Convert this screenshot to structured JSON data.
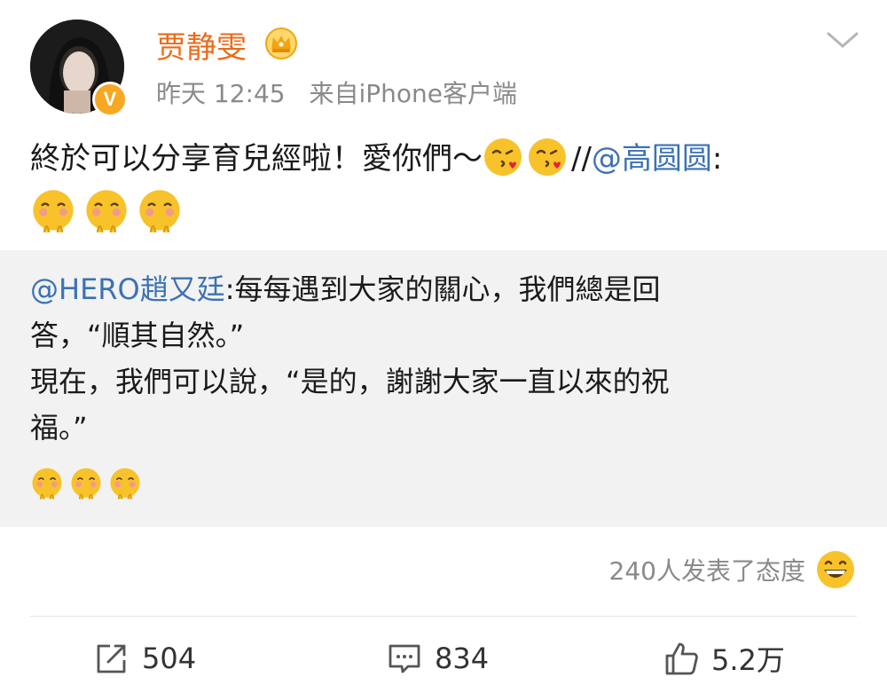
{
  "post": {
    "username": "贾静雯",
    "time": "昨天 12:45",
    "source": "来自iPhone客户端",
    "text": "終於可以分享育兒經啦！愛你們～",
    "repost_sep": "//",
    "mention": "@高圆圆",
    "mention_colon": ":"
  },
  "repost": {
    "mention": "@HERO趙又廷",
    "text_line1": ":每每遇到大家的關心，我們總是回",
    "text_line2": "答，“順其自然。”",
    "text_line3": "現在，我們可以說，“是的，謝謝大家一直以來的祝",
    "text_line4": "福。”"
  },
  "reactions": {
    "text": "240人发表了态度"
  },
  "actions": {
    "repost_count": "504",
    "comment_count": "834",
    "like_count": "5.2万"
  },
  "colors": {
    "username": "#ec6a19",
    "mention": "#3b72b6",
    "meta": "#8a8a8a",
    "repost_bg": "#f2f2f2",
    "emoji": "#f8c22a"
  },
  "icons": [
    "crown-icon",
    "verified-v-icon",
    "chevron-down-icon",
    "kiss-emoji-icon",
    "shy-emoji-icon",
    "grin-emoji-icon",
    "repost-icon",
    "comment-icon",
    "like-icon"
  ]
}
